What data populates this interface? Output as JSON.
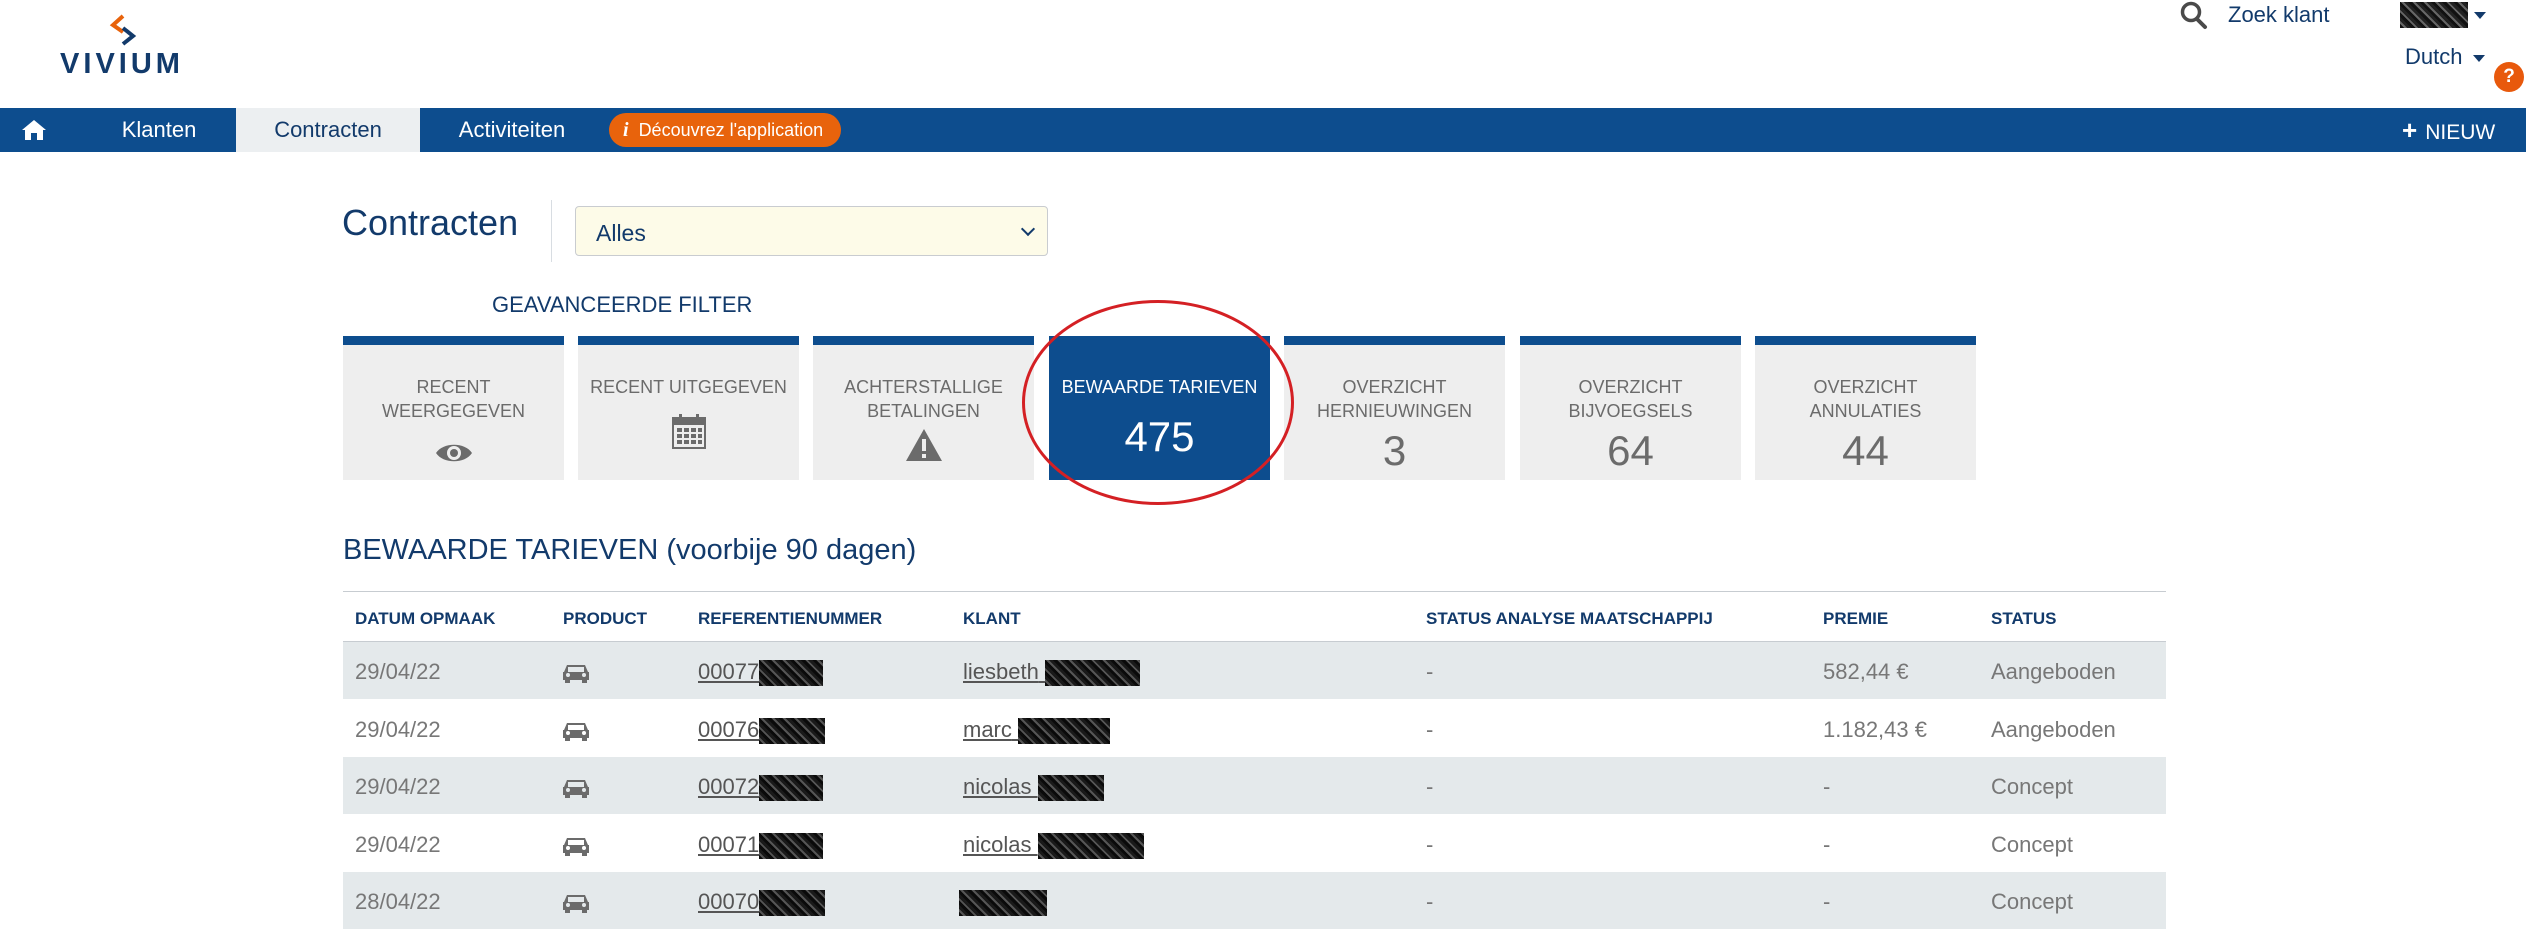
{
  "brand": {
    "logo_word": "VIVIUM"
  },
  "header": {
    "search_label": "Zoek klant",
    "language": "Dutch",
    "help": "?"
  },
  "nav": {
    "home_icon": "home-icon",
    "items": [
      "Klanten",
      "Contracten",
      "Activiteiten"
    ],
    "active": "Contracten",
    "promo_icon": "i",
    "promo_label": "Découvrez l'application",
    "new_label": "NIEUW"
  },
  "page": {
    "title": "Contracten",
    "select_value": "Alles",
    "advanced_filter": "GEAVANCEERDE FILTER"
  },
  "tiles": [
    {
      "label": "RECENT WEERGEGEVEN",
      "icon": "eye-icon"
    },
    {
      "label": "RECENT UITGEGEVEN",
      "icon": "calendar-icon"
    },
    {
      "label": "ACHTERSTALLIGE BETALINGEN",
      "icon": "warning-icon"
    },
    {
      "label": "BEWAARDE TARIEVEN",
      "value": "475",
      "active": true
    },
    {
      "label": "OVERZICHT HERNIEUWINGEN",
      "value": "3"
    },
    {
      "label": "OVERZICHT BIJVOEGSELS",
      "value": "64"
    },
    {
      "label": "OVERZICHT ANNULATIES",
      "value": "44"
    }
  ],
  "section": {
    "title": "BEWAARDE TARIEVEN (voorbije 90 dagen)"
  },
  "table": {
    "columns": [
      "DATUM OPMAAK",
      "PRODUCT",
      "REFERENTIENUMMER",
      "KLANT",
      "STATUS ANALYSE MAATSCHAPPIJ",
      "PREMIE",
      "STATUS"
    ],
    "rows": [
      {
        "date": "29/04/22",
        "product": "car-icon",
        "ref": "00077",
        "client": "liesbeth",
        "analysis": "-",
        "premium": "582,44 €",
        "status": "Aangeboden"
      },
      {
        "date": "29/04/22",
        "product": "car-icon",
        "ref": "00076",
        "client": "marc",
        "analysis": "-",
        "premium": "1.182,43 €",
        "status": "Aangeboden"
      },
      {
        "date": "29/04/22",
        "product": "car-icon",
        "ref": "00072",
        "client": "nicolas",
        "analysis": "-",
        "premium": "-",
        "status": "Concept"
      },
      {
        "date": "29/04/22",
        "product": "car-icon",
        "ref": "00071",
        "client": "nicolas",
        "analysis": "-",
        "premium": "-",
        "status": "Concept"
      },
      {
        "date": "28/04/22",
        "product": "car-icon",
        "ref": "00070",
        "client": "",
        "analysis": "-",
        "premium": "-",
        "status": "Concept"
      }
    ]
  },
  "colors": {
    "primary": "#0d4d8e",
    "accent": "#e8630c",
    "highlight": "#d42024",
    "row_alt": "#e4e9eb"
  }
}
